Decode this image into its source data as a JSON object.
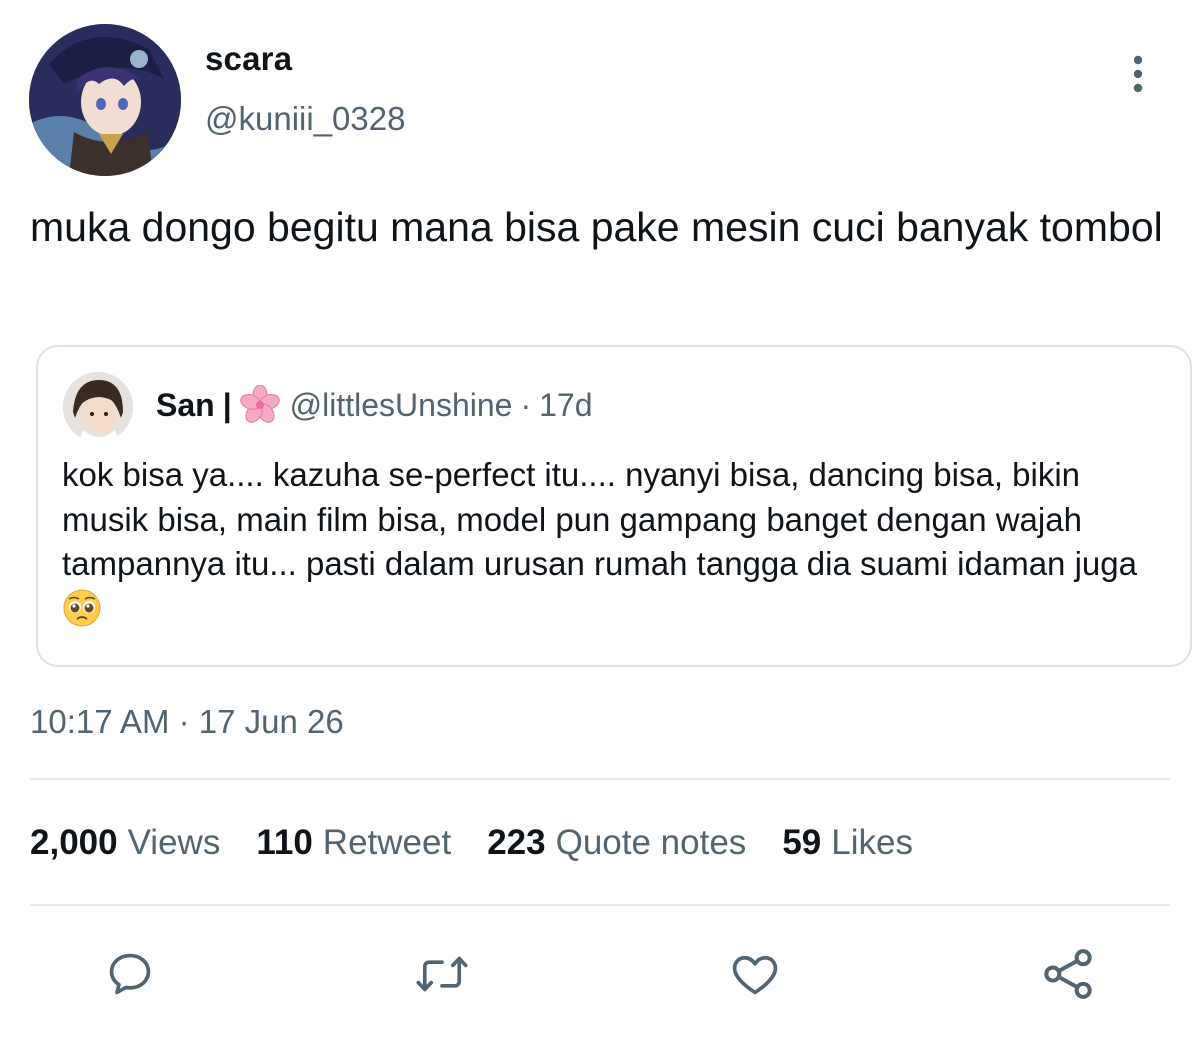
{
  "author": {
    "display_name": "scara",
    "handle": "@kuniii_0328",
    "avatar_icon": "anime-character-avatar"
  },
  "menu": {
    "icon": "more-vertical-icon"
  },
  "tweet": {
    "text": "muka dongo begitu mana bisa pake mesin cuci banyak tombol"
  },
  "quote": {
    "name": "San",
    "separator": "|",
    "name_icon": "cherry-blossom-icon",
    "handle": "@littlesUnshine",
    "dot": "·",
    "time": "17d",
    "text": "kok bisa ya.... kazuha se-perfect itu.... nyanyi bisa, dancing bisa, bikin musik bisa, main film bisa, model pun gampang banget dengan wajah tampannya itu... pasti dalam urusan rumah tangga dia suami idaman juga",
    "text_emoji": "pleading-face-icon"
  },
  "timestamp": "10:17 AM · 17 Jun 26",
  "stats": {
    "views": {
      "count": "2,000",
      "label": "Views"
    },
    "retweets": {
      "count": "110",
      "label": "Retweet"
    },
    "quotes": {
      "count": "223",
      "label": "Quote notes"
    },
    "likes": {
      "count": "59",
      "label": "Likes"
    }
  },
  "actions": {
    "reply": "reply-icon",
    "retweet": "retweet-icon",
    "like": "heart-icon",
    "share": "share-icon"
  },
  "colors": {
    "text_primary": "#0f1419",
    "text_secondary": "#536471",
    "border": "#dbe3e8",
    "divider": "#e5eaed"
  }
}
